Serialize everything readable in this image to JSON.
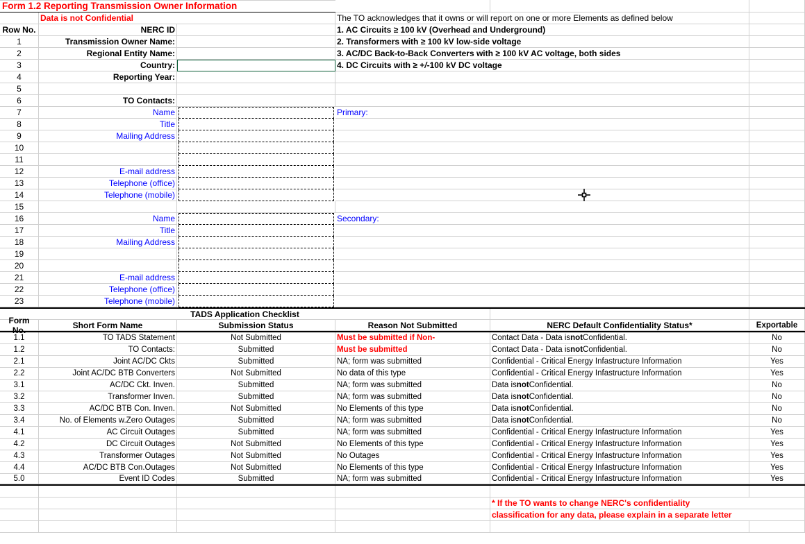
{
  "title": "Form 1.2 Reporting Transmission Owner Information",
  "confidential_note": "Data is not Confidential",
  "ack_text": "The TO acknowledges that it owns or will report on one or more Elements as defined below",
  "header": {
    "row_no": "Row No.",
    "nerc_id": "NERC ID"
  },
  "definitions": {
    "d1": "1.  AC Circuits ≥ 100 kV (Overhead and Underground)",
    "d2": "2.  Transformers with ≥ 100 kV low-side voltage",
    "d3": "3.  AC/DC Back-to-Back Converters with ≥ 100 kV AC voltage, both sides",
    "d4_pre": "4.  DC Circuits with ≥ +",
    "d4_mid": "/",
    "d4_post": "-100 kV DC voltage"
  },
  "rows": [
    {
      "n": "1",
      "label": "Transmission Owner Name:"
    },
    {
      "n": "2",
      "label": "Regional Entity Name:"
    },
    {
      "n": "3",
      "label": "Country:"
    },
    {
      "n": "4",
      "label": "Reporting Year:"
    },
    {
      "n": "5",
      "label": ""
    },
    {
      "n": "6",
      "label": "TO Contacts:"
    },
    {
      "n": "7",
      "label": "Name",
      "blue": true,
      "dash": true,
      "side": "Primary:",
      "first": true
    },
    {
      "n": "8",
      "label": "Title",
      "blue": true,
      "dash": true
    },
    {
      "n": "9",
      "label": "Mailing Address",
      "blue": true,
      "dash": true
    },
    {
      "n": "10",
      "label": "",
      "dash": true
    },
    {
      "n": "11",
      "label": "",
      "dash": true
    },
    {
      "n": "12",
      "label": "E-mail address",
      "blue": true,
      "dash": true
    },
    {
      "n": "13",
      "label": "Telephone (office)",
      "blue": true,
      "dash": true
    },
    {
      "n": "14",
      "label": "Telephone (mobile)",
      "blue": true,
      "dash": true,
      "last": true
    },
    {
      "n": "15",
      "label": ""
    },
    {
      "n": "16",
      "label": "Name",
      "blue": true,
      "dash": true,
      "side": "Secondary:",
      "first": true
    },
    {
      "n": "17",
      "label": "Title",
      "blue": true,
      "dash": true
    },
    {
      "n": "18",
      "label": "Mailing Address",
      "blue": true,
      "dash": true
    },
    {
      "n": "19",
      "label": "",
      "dash": true
    },
    {
      "n": "20",
      "label": "",
      "dash": true
    },
    {
      "n": "21",
      "label": "E-mail address",
      "blue": true,
      "dash": true
    },
    {
      "n": "22",
      "label": "Telephone (office)",
      "blue": true,
      "dash": true
    },
    {
      "n": "23",
      "label": "Telephone (mobile)",
      "blue": true,
      "dash": true,
      "last": true
    }
  ],
  "checklist_title": "TADS Application Checklist",
  "checklist_headers": {
    "form_no": "Form No.",
    "short_name": "Short Form Name",
    "status": "Submission Status",
    "reason": "Reason Not Submitted",
    "conf": "NERC Default Confidentiality Status*",
    "export": "Exportable"
  },
  "conf_text": {
    "contact_pre": "Contact Data - Data is ",
    "datais_pre": "Data is ",
    "not": "not",
    "contact_post": " Confidential.",
    "ccei": "Confidential - Critical Energy Infastructure Information"
  },
  "checklist": [
    {
      "fn": "1.1",
      "name": "TO TADS Statement",
      "status": "Not Submitted",
      "reason": "Must be submitted if Non-",
      "red": true,
      "conf": "contact",
      "export": "No"
    },
    {
      "fn": "1.2",
      "name": "TO Contacts:",
      "status": "Submitted",
      "reason": "Must be submitted",
      "red": true,
      "conf": "contact",
      "export": "No"
    },
    {
      "fn": "2.1",
      "name": "Joint AC/DC Ckts",
      "status": "Submitted",
      "reason": "NA; form was submitted",
      "conf": "ccei",
      "export": "Yes"
    },
    {
      "fn": "2.2",
      "name": "Joint AC/DC BTB Converters",
      "status": "Not Submitted",
      "reason": "No data of this type",
      "conf": "ccei",
      "export": "Yes"
    },
    {
      "fn": "3.1",
      "name": "AC/DC Ckt. Inven.",
      "status": "Submitted",
      "reason": "NA; form was submitted",
      "conf": "datais",
      "export": "No"
    },
    {
      "fn": "3.2",
      "name": "Transformer Inven.",
      "status": "Submitted",
      "reason": "NA; form was submitted",
      "conf": "datais",
      "export": "No"
    },
    {
      "fn": "3.3",
      "name": "AC/DC BTB Con. Inven.",
      "status": "Not Submitted",
      "reason": "No Elements of this type",
      "conf": "datais",
      "export": "No"
    },
    {
      "fn": "3.4",
      "name": "No. of Elements w.Zero Outages",
      "status": "Submitted",
      "reason": "NA; form was submitted",
      "conf": "datais",
      "export": "No"
    },
    {
      "fn": "4.1",
      "name": "AC Circuit Outages",
      "status": "Submitted",
      "reason": "NA; form was submitted",
      "conf": "ccei",
      "export": "Yes"
    },
    {
      "fn": "4.2",
      "name": "DC Circuit Outages",
      "status": "Not Submitted",
      "reason": "No Elements of this type",
      "conf": "ccei",
      "export": "Yes"
    },
    {
      "fn": "4.3",
      "name": "Transformer Outages",
      "status": "Not Submitted",
      "reason": "No Outages",
      "conf": "ccei",
      "export": "Yes"
    },
    {
      "fn": "4.4",
      "name": "AC/DC BTB Con.Outages",
      "status": "Not Submitted",
      "reason": "No Elements of this type",
      "conf": "ccei",
      "export": "Yes"
    },
    {
      "fn": "5.0",
      "name": "Event ID Codes",
      "status": "Submitted",
      "reason": "NA; form was submitted",
      "conf": "ccei",
      "export": "Yes"
    }
  ],
  "footer": {
    "line1": "* If the TO wants to change NERC's confidentiality",
    "line2": "classification for any data, please explain in a separate letter"
  }
}
